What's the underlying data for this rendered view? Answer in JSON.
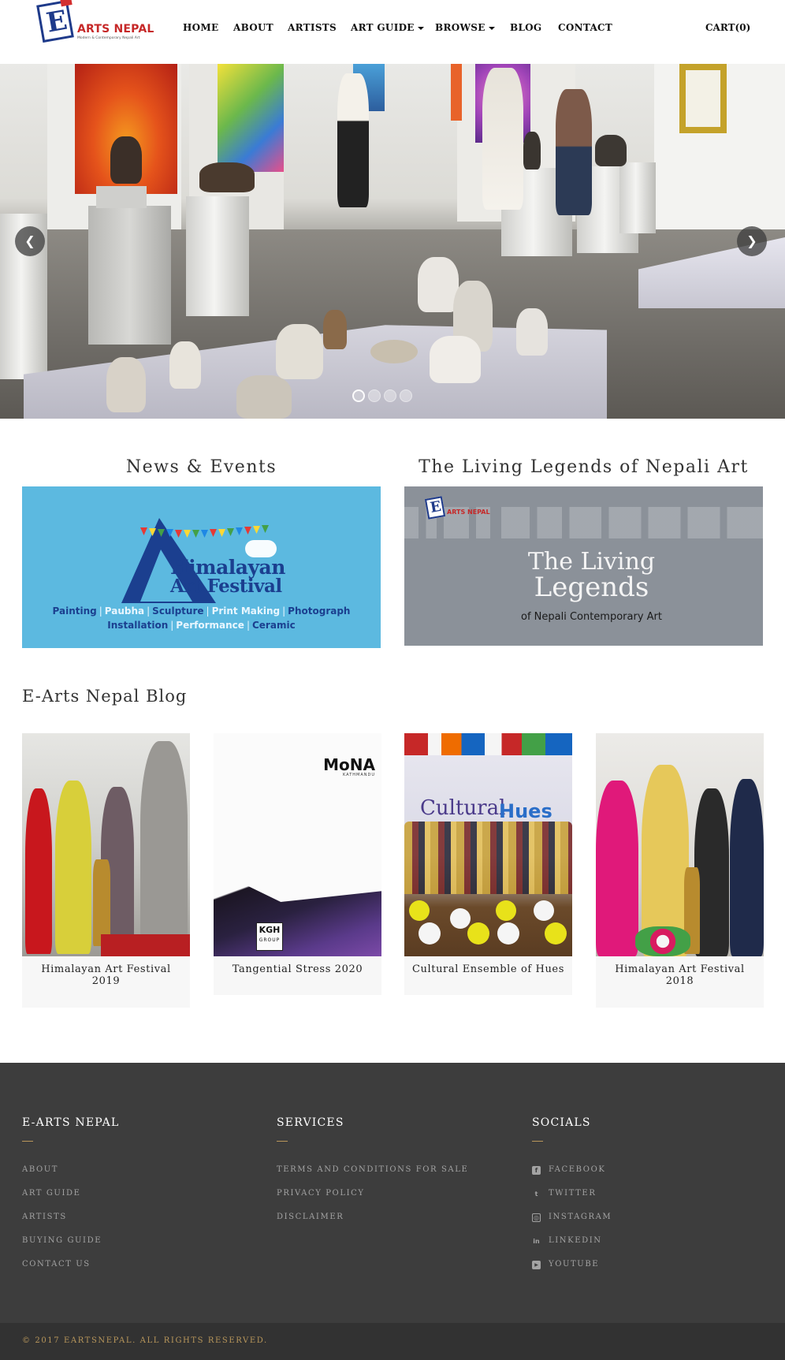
{
  "header": {
    "logo_title": "ARTS NEPAL",
    "logo_letter": "E",
    "logo_tagline": "Modern & Contemporary Nepali Art",
    "nav": [
      {
        "label": "HOME",
        "dropdown": false
      },
      {
        "label": "ABOUT",
        "dropdown": false
      },
      {
        "label": "ARTISTS",
        "dropdown": false
      },
      {
        "label": "ART GUIDE",
        "dropdown": true
      },
      {
        "label": "BROWSE",
        "dropdown": true
      },
      {
        "label": "BLOG",
        "dropdown": false
      },
      {
        "label": "CONTACT",
        "dropdown": false
      }
    ],
    "cart_label": "CART(0)"
  },
  "hero": {
    "prev_icon": "chevron-left-icon",
    "next_icon": "chevron-right-icon",
    "slide_count": 4,
    "active_slide": 1
  },
  "features": {
    "news_title": "News & Events",
    "legends_title": "The Living Legends of Nepali Art",
    "news_banner": {
      "line1": "Himalayan",
      "line2": "Art Festival",
      "categories_row1": [
        "Painting",
        "Paubha",
        "Sculpture",
        "Print Making",
        "Photograph"
      ],
      "categories_row2": [
        "Installation",
        "Performance",
        "Ceramic"
      ]
    },
    "legends_banner": {
      "logo_letter": "E",
      "logo_text": "ARTS NEPAL",
      "line1": "The Living",
      "line2": "Legends",
      "line3": "of Nepali Contemporary Art"
    }
  },
  "blog": {
    "heading": "E-Arts Nepal Blog",
    "posts": [
      {
        "title": "Himalayan Art Festival 2019"
      },
      {
        "title": "Tangential Stress 2020",
        "image_text_1": "MoNA",
        "image_text_2": "KATHMANDU",
        "image_text_3": "KGH",
        "image_text_4": "GROUP"
      },
      {
        "title": "Cultural Ensemble of Hues",
        "image_text_1": "Cultural",
        "image_text_2": "Hues"
      },
      {
        "title": "Himalayan Art Festival 2018"
      }
    ]
  },
  "footer": {
    "col1": {
      "heading": "E-ARTS NEPAL",
      "links": [
        "About",
        "Art Guide",
        "Artists",
        "Buying Guide",
        "Contact Us"
      ]
    },
    "col2": {
      "heading": "SERVICES",
      "links": [
        "Terms and Conditions for Sale",
        "Privacy Policy",
        "Disclaimer"
      ]
    },
    "col3": {
      "heading": "SOCIALS",
      "links": [
        {
          "label": "Facebook",
          "icon": "facebook-icon",
          "glyph": "f"
        },
        {
          "label": "Twitter",
          "icon": "twitter-icon",
          "glyph": "t"
        },
        {
          "label": "Instagram",
          "icon": "instagram-icon",
          "glyph": "◎"
        },
        {
          "label": "LinkedIn",
          "icon": "linkedin-icon",
          "glyph": "in"
        },
        {
          "label": "YouTube",
          "icon": "youtube-icon",
          "glyph": "▶"
        }
      ]
    },
    "copyright": "© 2017 EARTSNEPAL. ALL RIGHTS RESERVED."
  },
  "colors": {
    "footer_bg": "#3d3d3d",
    "copyright_bg": "#323232",
    "accent_gold": "#b9975b",
    "news_banner_bg": "#5cb9e0",
    "legends_banner_bg": "#8b9199",
    "logo_red": "#c62828",
    "logo_blue": "#1e3a8a"
  }
}
